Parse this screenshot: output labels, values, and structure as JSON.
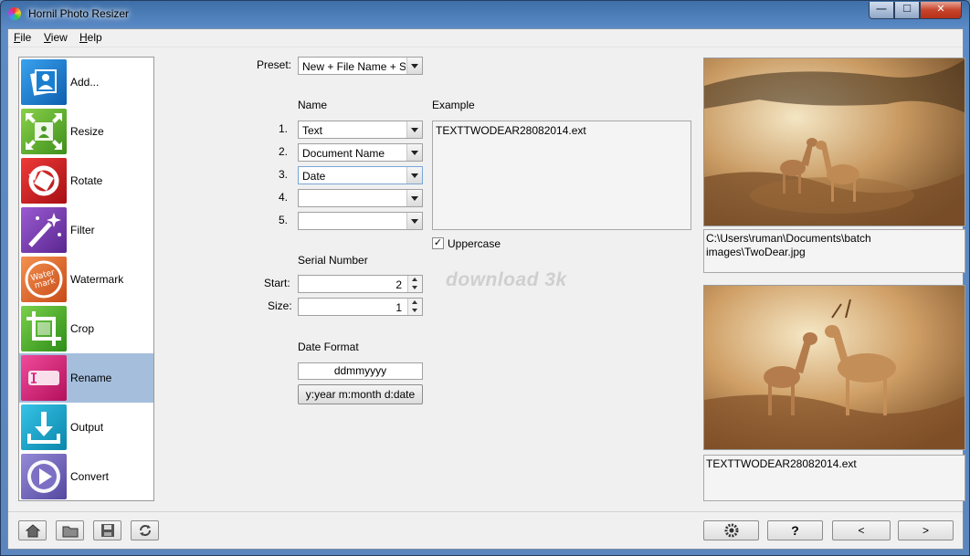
{
  "window": {
    "title": "Hornil Photo Resizer",
    "minimize": "—",
    "maximize": "☐",
    "close": "✕"
  },
  "menu": [
    {
      "label": "File",
      "key": "F"
    },
    {
      "label": "View",
      "key": "V"
    },
    {
      "label": "Help",
      "key": "H"
    }
  ],
  "sidebar": {
    "items": [
      {
        "label": "Add...",
        "icon": "add-photo-icon",
        "color": "#1b7fd0"
      },
      {
        "label": "Resize",
        "icon": "resize-icon",
        "color": "#5aa82a"
      },
      {
        "label": "Rotate",
        "icon": "rotate-icon",
        "color": "#d6262a"
      },
      {
        "label": "Filter",
        "icon": "magic-wand-icon",
        "color": "#7b3da8"
      },
      {
        "label": "Watermark",
        "icon": "watermark-icon",
        "color": "#e86b2d"
      },
      {
        "label": "Crop",
        "icon": "crop-icon",
        "color": "#4caf2c"
      },
      {
        "label": "Rename",
        "icon": "rename-icon",
        "color": "#d81f7a"
      },
      {
        "label": "Output",
        "icon": "download-icon",
        "color": "#17a3c8"
      },
      {
        "label": "Convert",
        "icon": "play-icon",
        "color": "#6f63b5"
      }
    ],
    "active_index": 6
  },
  "rename": {
    "preset_label": "Preset:",
    "preset_value": "New + File Name + Se",
    "name_heading": "Name",
    "example_heading": "Example",
    "rows": [
      {
        "num": "1.",
        "value": "Text"
      },
      {
        "num": "2.",
        "value": "Document Name"
      },
      {
        "num": "3.",
        "value": "Date"
      },
      {
        "num": "4.",
        "value": ""
      },
      {
        "num": "5.",
        "value": ""
      }
    ],
    "example_value": "TEXTTWODEAR28082014.ext",
    "uppercase_label": "Uppercase",
    "uppercase_checked": true,
    "serial_heading": "Serial Number",
    "start_label": "Start:",
    "start_value": "2",
    "size_label": "Size:",
    "size_value": "1",
    "date_heading": "Date Format",
    "date_value": "ddmmyyyy",
    "date_hint": "y:year m:month d:date"
  },
  "preview": {
    "source_path": "C:\\Users\\ruman\\Documents\\batch images\\TwoDear.jpg",
    "result_name": "TEXTTWODEAR28082014.ext"
  },
  "watermark_text": "download 3k",
  "toolbar": {
    "help_label": "?",
    "prev_label": "<",
    "next_label": ">"
  }
}
